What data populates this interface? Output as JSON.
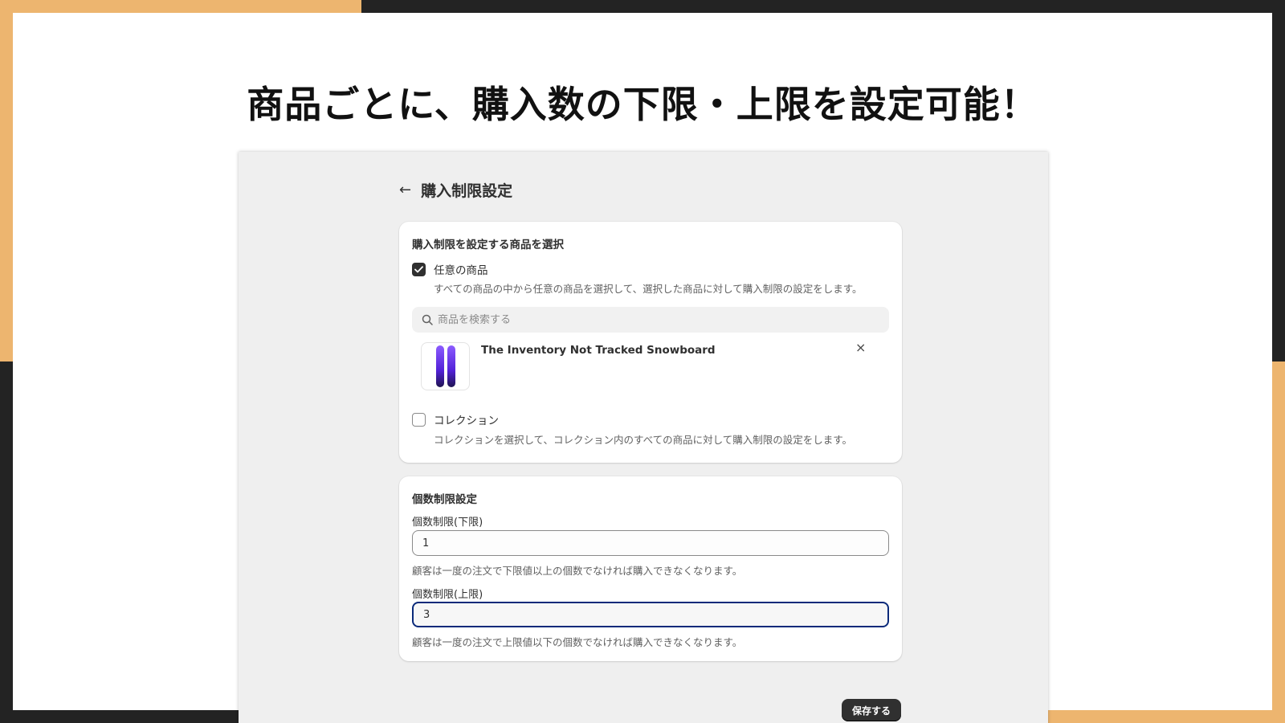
{
  "headline": "商品ごとに、購入数の下限・上限を設定可能！",
  "page": {
    "back_icon": "←",
    "title": "購入制限設定"
  },
  "product_card": {
    "title": "購入制限を設定する商品を選択",
    "option_any": {
      "label": "任意の商品",
      "checked": true,
      "help": "すべての商品の中から任意の商品を選択して、選択した商品に対して購入制限の設定をします。"
    },
    "search": {
      "placeholder": "商品を検索する"
    },
    "selected_product": {
      "name": "The Inventory Not Tracked Snowboard",
      "remove_icon": "×"
    },
    "option_collection": {
      "label": "コレクション",
      "checked": false,
      "help": "コレクションを選択して、コレクション内のすべての商品に対して購入制限の設定をします。"
    }
  },
  "limit_card": {
    "title": "個数制限設定",
    "min": {
      "label": "個数制限(下限)",
      "value": "1",
      "help": "顧客は一度の注文で下限値以上の個数でなければ購入できなくなります。"
    },
    "max": {
      "label": "個数制限(上限)",
      "value": "3",
      "help": "顧客は一度の注文で上限値以下の個数でなければ購入できなくなります。"
    }
  },
  "save_label": "保存する",
  "colors": {
    "accent": "#EDB56F",
    "frame": "#232323",
    "primary_button": "#303030",
    "focus_ring": "#0A2A7A"
  }
}
